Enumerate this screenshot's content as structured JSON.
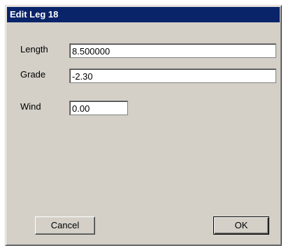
{
  "window": {
    "title": "Edit Leg 18"
  },
  "fields": {
    "length": {
      "label": "Length",
      "value": "8.500000"
    },
    "grade": {
      "label": "Grade",
      "value": "-2.30"
    },
    "wind": {
      "label": "Wind",
      "value": "0.00"
    }
  },
  "buttons": {
    "cancel_label": "Cancel",
    "ok_label": "OK"
  },
  "colors": {
    "titlebar": "#0a246a",
    "face": "#d4d0c8"
  }
}
